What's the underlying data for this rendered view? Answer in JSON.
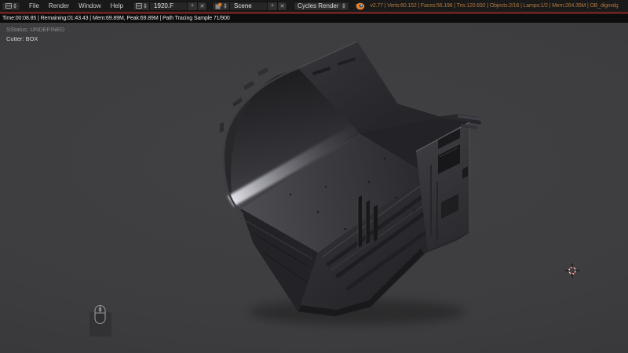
{
  "header": {
    "menus": [
      "File",
      "Render",
      "Window",
      "Help"
    ],
    "layout_selector": {
      "value": "1920.F",
      "add_label": "+",
      "close_label": "✕"
    },
    "scene_selector": {
      "value": "Scene",
      "add_label": "+",
      "close_label": "✕"
    },
    "engine_selector": {
      "value": "Cycles Render"
    },
    "stats_text": "v2.77 | Verts:60.152 | Faces:56.196 | Tris:120.692 | Objects:2/16 | Lamps:1/2 | Mem:264.35M | OB_diginslg"
  },
  "render_status_bar": {
    "text": "Time:00:08.85 | Remaining:01:43.43 | Mem:69.89M, Peak:69.89M | Path Tracing Sample 71/900"
  },
  "viewport": {
    "status_line": "SStatus: UNDEFINED",
    "object_line": "Cutter: BOX"
  },
  "colors": {
    "header_bg": "#191919",
    "status_bar_bg": "#0d0d0d",
    "progress_red": "#5c1e1e",
    "stats_orange": "#b0793f",
    "viewport_gray": "#3e3e40",
    "blender_orange": "#e8822d"
  }
}
